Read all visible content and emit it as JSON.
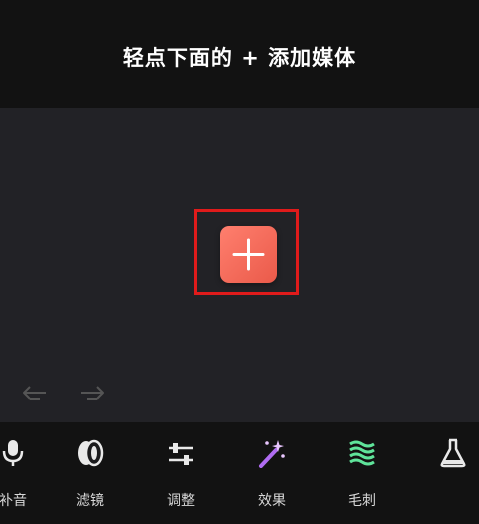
{
  "header": {
    "title": "轻点下面的 + 添加媒体"
  },
  "canvas": {
    "add_button_icon": "plus-icon",
    "undo_icon": "undo-icon",
    "redo_icon": "redo-icon"
  },
  "toolbar": {
    "items": [
      {
        "label": "补音",
        "icon": "microphone-icon"
      },
      {
        "label": "滤镜",
        "icon": "filter-icon"
      },
      {
        "label": "调整",
        "icon": "sliders-icon"
      },
      {
        "label": "效果",
        "icon": "magic-wand-icon"
      },
      {
        "label": "毛刺",
        "icon": "glitch-icon"
      },
      {
        "label": "",
        "icon": "flask-icon"
      }
    ]
  },
  "colors": {
    "accent": "#f06a59",
    "highlight_box": "#e01b1b",
    "effect_icon": "#b06cf2",
    "glitch_icon": "#5fe39a"
  }
}
